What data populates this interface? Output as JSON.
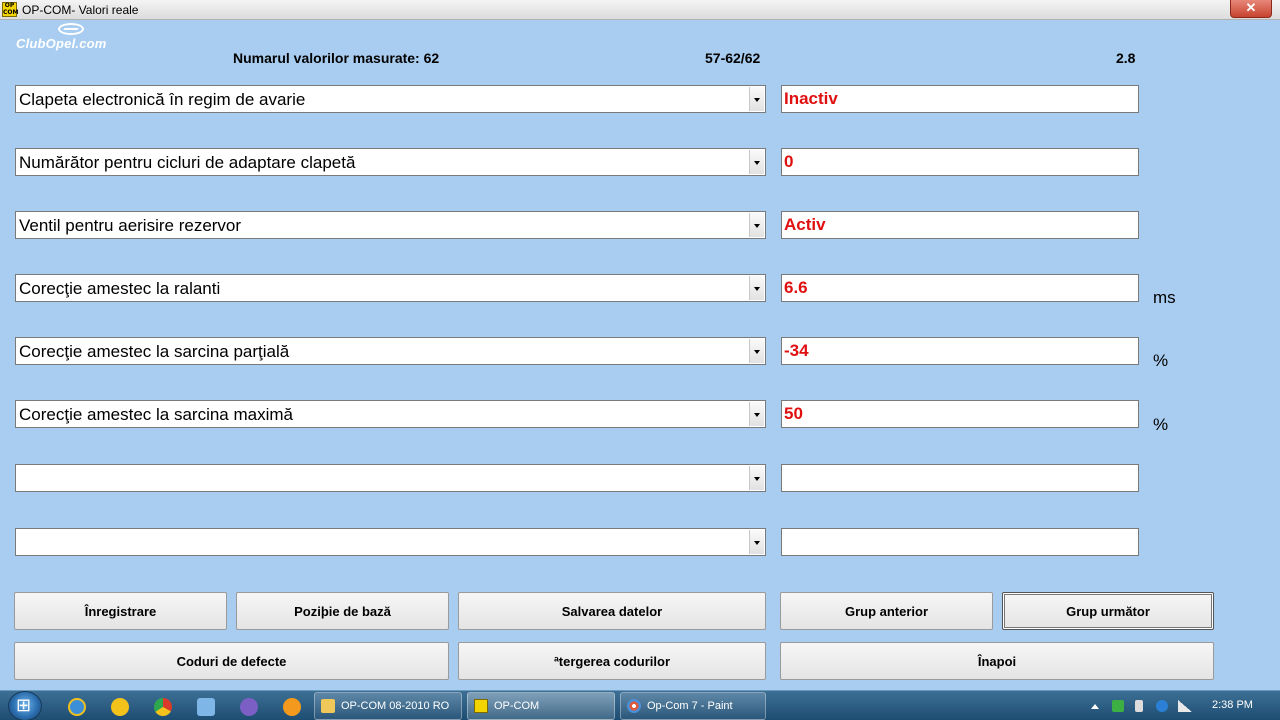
{
  "window": {
    "title": "OP-COM- Valori reale",
    "app_icon_line1": "OP",
    "app_icon_line2": "COM",
    "close_glyph": "✕"
  },
  "logo": {
    "text": "ClubOpel.com"
  },
  "header": {
    "count_label": "Numarul valorilor masurate: 62",
    "range": "57-62/62",
    "version": "2.8"
  },
  "rows": [
    {
      "label": "Clapeta electronică în regim de avarie",
      "value": "Inactiv",
      "unit": ""
    },
    {
      "label": "Numărător pentru cicluri de adaptare clapetă",
      "value": "0",
      "unit": ""
    },
    {
      "label": "Ventil pentru aerisire rezervor",
      "value": "Activ",
      "unit": ""
    },
    {
      "label": "Corecţie amestec la ralanti",
      "value": "6.6",
      "unit": "ms"
    },
    {
      "label": "Corecţie amestec la sarcina parţială",
      "value": "-34",
      "unit": "%"
    },
    {
      "label": "Corecţie amestec la sarcina maximă",
      "value": "50",
      "unit": "%"
    },
    {
      "label": "",
      "value": "",
      "unit": ""
    },
    {
      "label": "",
      "value": "",
      "unit": ""
    }
  ],
  "buttons": {
    "record": "Înregistrare",
    "base_position": "Poziþie de bază",
    "save_data": "Salvarea datelor",
    "prev_group": "Grup anterior",
    "next_group": "Grup următor",
    "fault_codes": "Coduri de defecte",
    "clear_codes": "ªtergerea codurilor",
    "back": "Înapoi"
  },
  "taskbar": {
    "tasks": [
      {
        "label": "OP-COM 08-2010 RO"
      },
      {
        "label": "OP-COM"
      },
      {
        "label": "Op-Com 7 - Paint"
      }
    ],
    "clock": "2:38 PM"
  },
  "colors": {
    "background": "#a9cdf0",
    "value_text": "#e01010",
    "taskbar": "#1e4d72"
  }
}
